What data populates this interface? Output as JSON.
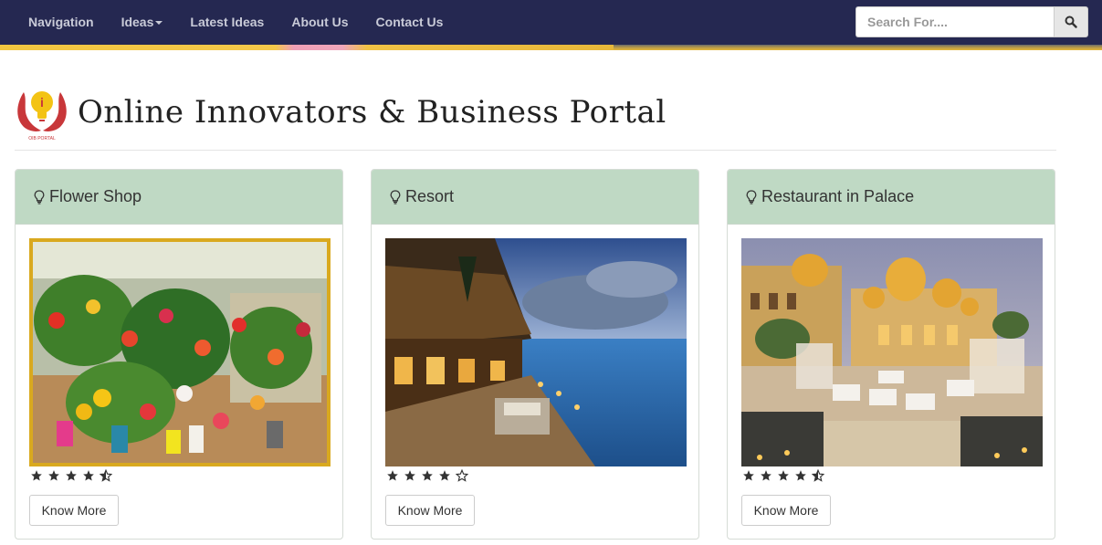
{
  "navbar": {
    "items": [
      {
        "label": "Navigation"
      },
      {
        "label": "Ideas"
      },
      {
        "label": "Latest Ideas"
      },
      {
        "label": "About Us"
      },
      {
        "label": "Contact Us"
      }
    ],
    "search": {
      "placeholder": "Search For...."
    }
  },
  "header": {
    "logo_text": "OIB PORTAL",
    "title": "Online Innovators & Business Portal"
  },
  "cards": [
    {
      "title": "Flower Shop",
      "rating": 4.5,
      "button_label": "Know More"
    },
    {
      "title": "Resort",
      "rating": 4,
      "button_label": "Know More"
    },
    {
      "title": "Restaurant in Palace",
      "rating": 4.5,
      "button_label": "Know More"
    }
  ],
  "colors": {
    "navbar_bg": "#252851",
    "card_header_bg": "#bfd9c4",
    "logo_red": "#c8373a",
    "logo_yellow": "#f3c315"
  }
}
